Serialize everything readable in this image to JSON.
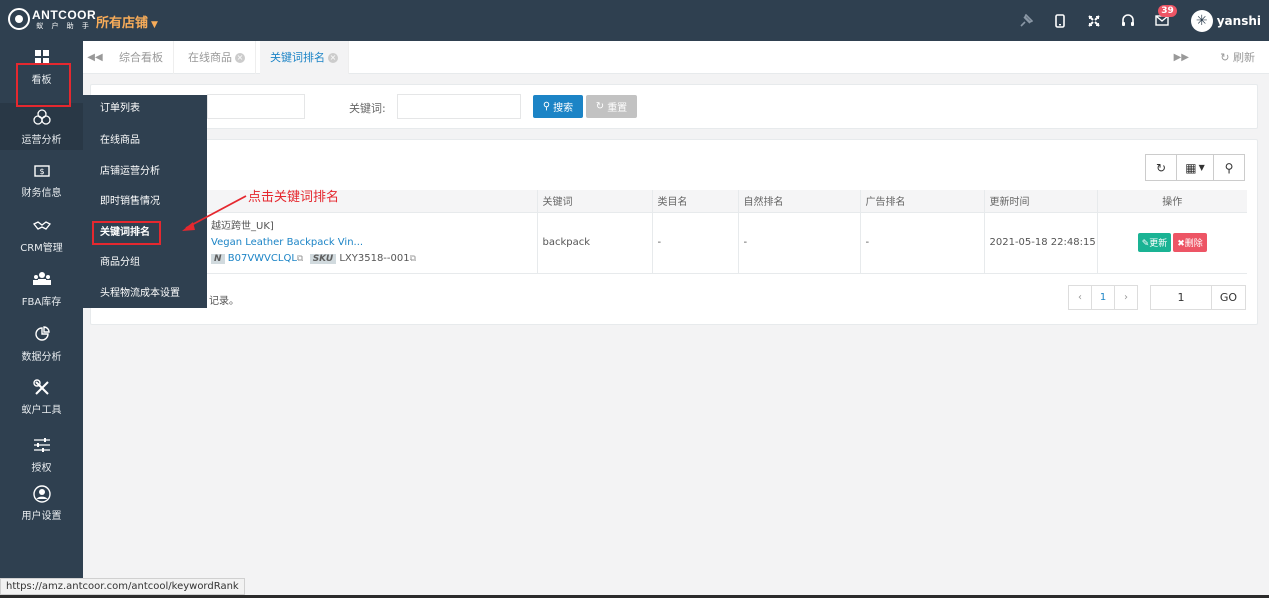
{
  "topbar": {
    "logo_main": "ANTCOOR",
    "logo_sub": "蚁 户 助 手",
    "store_selector": "所有店铺",
    "notification_count": "39",
    "username": "yanshi"
  },
  "sidebar": {
    "items": [
      {
        "label": "看板",
        "icon": "dashboard-icon"
      },
      {
        "label": "运营分析",
        "icon": "operations-icon"
      },
      {
        "label": "财务信息",
        "icon": "finance-icon"
      },
      {
        "label": "CRM管理",
        "icon": "crm-icon"
      },
      {
        "label": "FBA库存",
        "icon": "inventory-icon"
      },
      {
        "label": "数据分析",
        "icon": "chart-icon"
      },
      {
        "label": "蚁户工具",
        "icon": "tools-icon"
      },
      {
        "label": "授权",
        "icon": "sliders-icon"
      },
      {
        "label": "用户设置",
        "icon": "user-icon"
      }
    ]
  },
  "submenu": {
    "items": [
      "订单列表",
      "在线商品",
      "店铺运营分析",
      "即时销售情况",
      "关键词排名",
      "商品分组",
      "头程物流成本设置"
    ]
  },
  "tabs": {
    "items": [
      "综合看板",
      "在线商品",
      "关键词排名"
    ],
    "refresh_label": "刷新"
  },
  "search": {
    "keyword_label": "关键词:",
    "search_button": "搜索",
    "reset_button": "重置"
  },
  "table": {
    "headers": [
      "关键词",
      "类目名",
      "自然排名",
      "广告排名",
      "更新时间",
      "操作"
    ],
    "row": {
      "product_line1": "越迈跨世_UK]",
      "product_line2": "Vegan Leather Backpack Vin...",
      "asin_tag": "N",
      "asin": "B07VWVCLQL",
      "sku_tag": "SKU",
      "sku": "LXY3518--001",
      "keyword": "backpack",
      "category": "-",
      "natural_rank": "-",
      "ad_rank": "-",
      "updated": "2021-05-18 22:48:15",
      "update_button": "更新",
      "delete_button": "删除"
    }
  },
  "footer": {
    "records_text": "记录。",
    "current_page": "1",
    "page_input": "1",
    "go_label": "GO"
  },
  "annotation": {
    "text": "点击关键词排名"
  },
  "status_url": "https://amz.antcoor.com/antcool/keywordRank",
  "colors": {
    "nav_bg": "#2f4050",
    "accent": "#1c84c6",
    "highlight_red": "#e5282f",
    "success": "#1ab394",
    "danger": "#ed5565",
    "store_orange": "#f8ac59"
  }
}
